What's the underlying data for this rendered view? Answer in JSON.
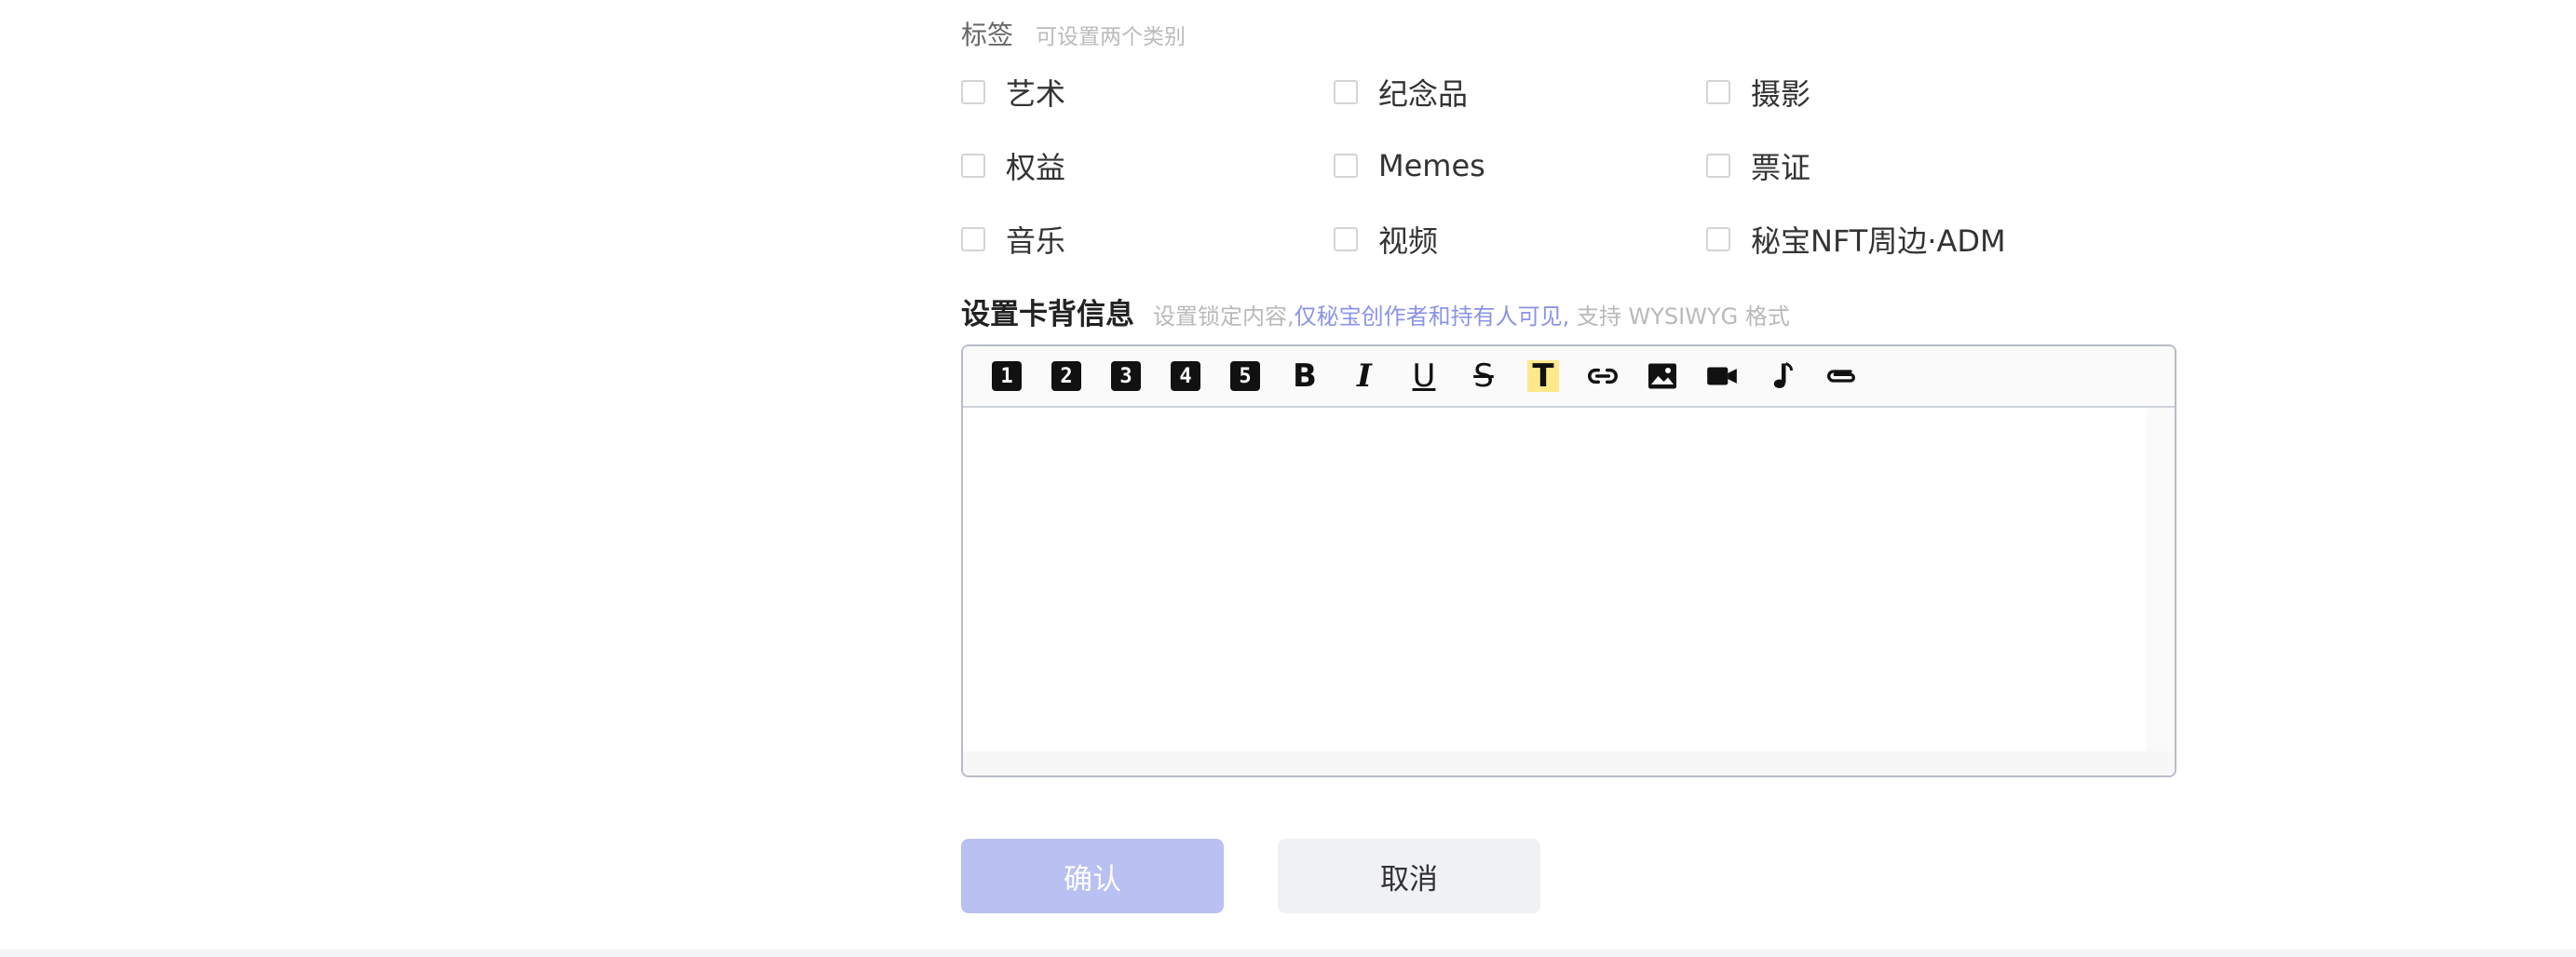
{
  "tags": {
    "title": "标签",
    "hint": "可设置两个类别",
    "options": [
      [
        "艺术",
        "纪念品",
        "摄影"
      ],
      [
        "权益",
        "Memes",
        "票证"
      ],
      [
        "音乐",
        "视频",
        "秘宝NFT周边·ADM"
      ]
    ]
  },
  "card_back": {
    "title": "设置卡背信息",
    "hint_prefix": "设置锁定内容,",
    "hint_accent": "仅秘宝创作者和持有人可见,",
    "hint_suffix": " 支持 WYSIWYG 格式"
  },
  "toolbar": {
    "headings": [
      "1",
      "2",
      "3",
      "4",
      "5"
    ],
    "bold": "B",
    "italic": "I",
    "underline": "U",
    "strike": "S",
    "highlight": "T",
    "icons": [
      "link-icon",
      "image-icon",
      "video-icon",
      "music-icon",
      "attachment-icon"
    ]
  },
  "colors": {
    "accent": "#8a93e6",
    "confirm_bg": "#b9c0f2",
    "cancel_bg": "#eff1f5",
    "highlight": "#ffe98a"
  },
  "actions": {
    "confirm": "确认",
    "cancel": "取消"
  }
}
